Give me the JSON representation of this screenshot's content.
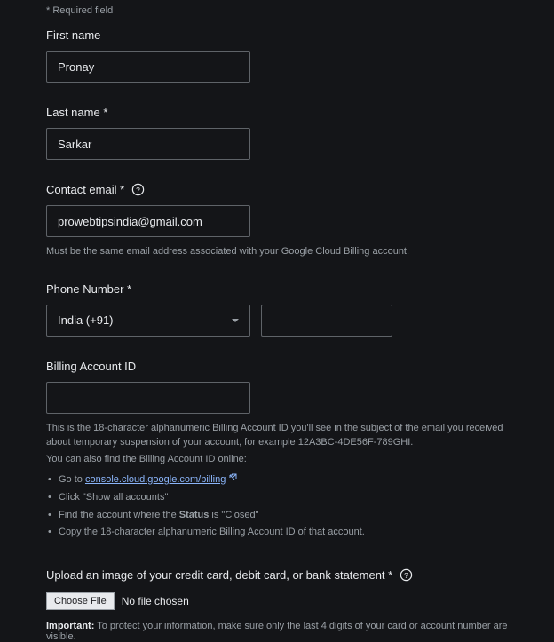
{
  "required_note": "* Required field",
  "first_name": {
    "label": "First name",
    "value": "Pronay"
  },
  "last_name": {
    "label": "Last name *",
    "value": "Sarkar"
  },
  "email": {
    "label": "Contact email *",
    "value": "prowebtipsindia@gmail.com",
    "help": "Must be the same email address associated with your Google Cloud Billing account."
  },
  "phone": {
    "label": "Phone Number *",
    "country": "India (+91)",
    "number": ""
  },
  "billing": {
    "label": "Billing Account ID",
    "value": "",
    "help1": "This is the 18-character alphanumeric Billing Account ID you'll see in the subject of the email you received about temporary suspension of your account, for example 12A3BC-4DE56F-789GHI.",
    "help2": "You can also find the Billing Account ID online:",
    "list": {
      "i0_prefix": "Go to ",
      "i0_link": "console.cloud.google.com/billing",
      "i1": "Click \"Show all accounts\"",
      "i2_a": "Find the account where the ",
      "i2_b": "Status",
      "i2_c": " is \"Closed\"",
      "i3": "Copy the 18-character alphanumeric Billing Account ID of that account."
    }
  },
  "upload": {
    "label": "Upload an image of your credit card, debit card, or bank statement *",
    "button": "Choose File",
    "status": "No file chosen",
    "important_label": "Important:",
    "important_text": " To protect your information, make sure only the last 4 digits of your card or account number are visible."
  }
}
